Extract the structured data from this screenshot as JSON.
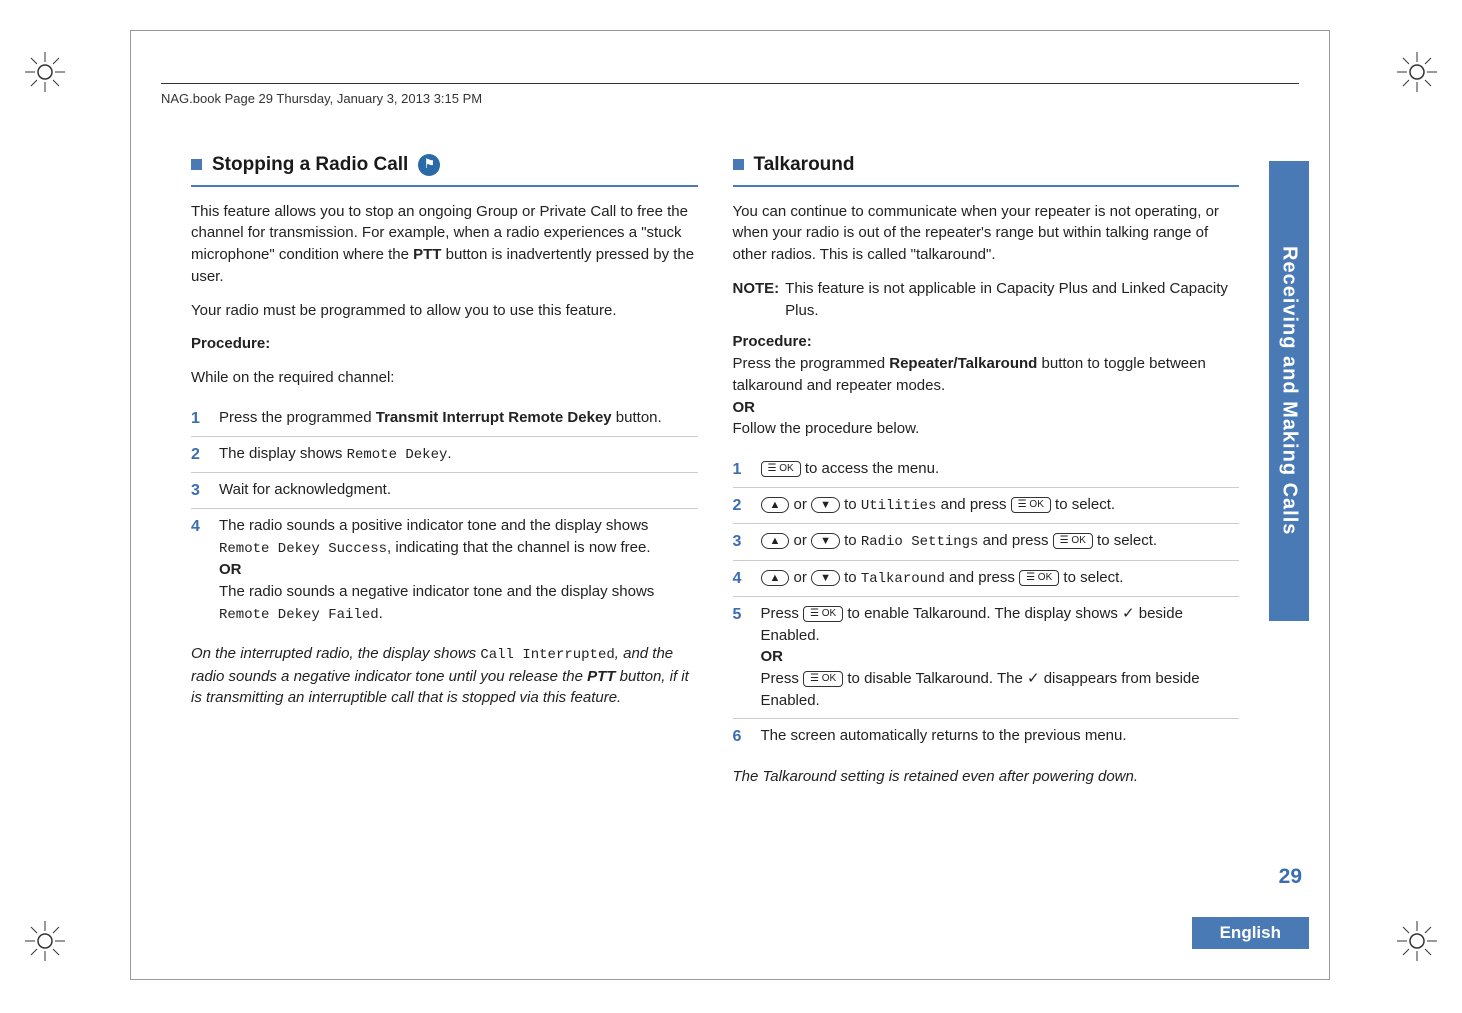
{
  "header": "NAG.book  Page 29  Thursday, January 3, 2013  3:15 PM",
  "left": {
    "title": "Stopping a Radio Call",
    "icon_glyph": "⚑",
    "p1a": "This feature allows you to stop an ongoing Group or Private Call to free the channel for transmission. For example, when a radio experiences a \"stuck microphone\" condition where the ",
    "p1b": "PTT",
    "p1c": " button is inadvertently pressed by the user.",
    "p2": "Your radio must be programmed to allow you to use this feature.",
    "proc_label": "Procedure:",
    "p3": "While on the required channel:",
    "steps": [
      {
        "num": "1",
        "a": "Press the programmed ",
        "b": "Transmit Interrupt Remote Dekey",
        "c": " button."
      },
      {
        "num": "2",
        "a": "The display shows ",
        "mono": "Remote Dekey",
        "c": "."
      },
      {
        "num": "3",
        "a": "Wait for acknowledgment."
      },
      {
        "num": "4",
        "a": "The radio sounds a positive indicator tone and the display shows ",
        "mono": "Remote Dekey Success",
        "c": ", indicating that the channel is now free.",
        "or": "OR",
        "d": "The radio sounds a negative indicator tone and the display shows ",
        "mono2": "Remote Dekey Failed",
        "e": "."
      }
    ],
    "footer_a": "On the interrupted radio, the display shows ",
    "footer_mono": "Call Interrupted",
    "footer_b": ", and the radio sounds a negative indicator tone until you release the ",
    "footer_bold": "PTT",
    "footer_c": " button, if it is transmitting an interruptible call that is stopped via this feature."
  },
  "right": {
    "title": "Talkaround",
    "p1": "You can continue to communicate when your repeater is not operating, or when your radio is out of the repeater's range but within talking range of other radios. This is called \"talkaround\".",
    "note_label": "NOTE:",
    "note_text": "This feature is not applicable in Capacity Plus and Linked Capacity Plus.",
    "proc_label": "Procedure:",
    "p2a": "Press the programmed ",
    "p2b": "Repeater/Talkaround",
    "p2c": " button to toggle between talkaround and repeater modes.",
    "or1": "OR",
    "p3": "Follow the procedure below.",
    "key_ok": "☰ OK",
    "key_up": "▲",
    "key_down": "▼",
    "steps": [
      {
        "num": "1",
        "pre": "",
        "mid": " to access the menu."
      },
      {
        "num": "2",
        "mono": "Utilities",
        "tail": " to select."
      },
      {
        "num": "3",
        "mono": "Radio Settings",
        "tail": " to select."
      },
      {
        "num": "4",
        "mono": "Talkaround",
        "tail": " to select."
      },
      {
        "num": "5",
        "a": " to enable Talkaround. The display shows ✓ beside Enabled.",
        "or": "OR",
        "b": " to disable Talkaround. The ✓ disappears from beside Enabled."
      },
      {
        "num": "6",
        "text": "The screen automatically returns to the previous menu."
      }
    ],
    "footer": "The Talkaround setting is retained even after powering down."
  },
  "side_tab": "Receiving and Making Calls",
  "page_number": "29",
  "language": "English"
}
